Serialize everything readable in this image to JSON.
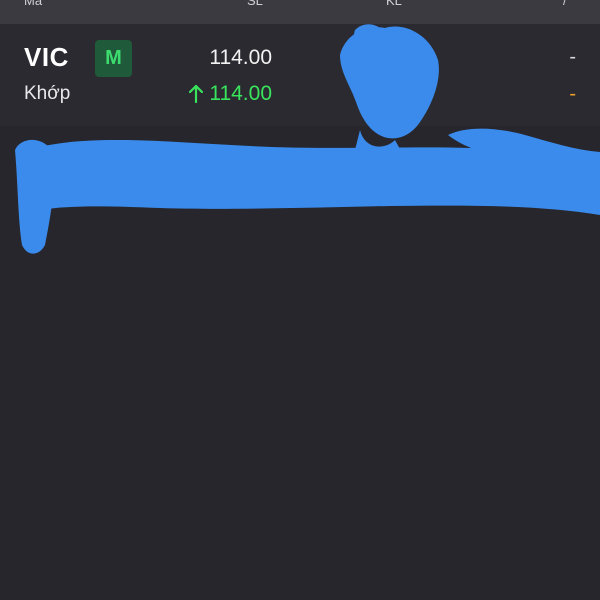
{
  "header": {
    "labels": [
      "Mã",
      "SL",
      "KL",
      "/"
    ]
  },
  "order": {
    "symbol": "VIC",
    "badge": "M",
    "price": "114.00",
    "status": "Khớp",
    "matched_price": "114.00",
    "right_value_1": "-",
    "right_value_2": "-"
  },
  "colors": {
    "up": "#39e45d",
    "badge_bg": "#1f5a3a",
    "badge_text": "#3ddc6f",
    "orange": "#f3a12b",
    "redaction": "#3b8bec"
  },
  "icons": {
    "matched_direction": "up-arrow-icon"
  }
}
